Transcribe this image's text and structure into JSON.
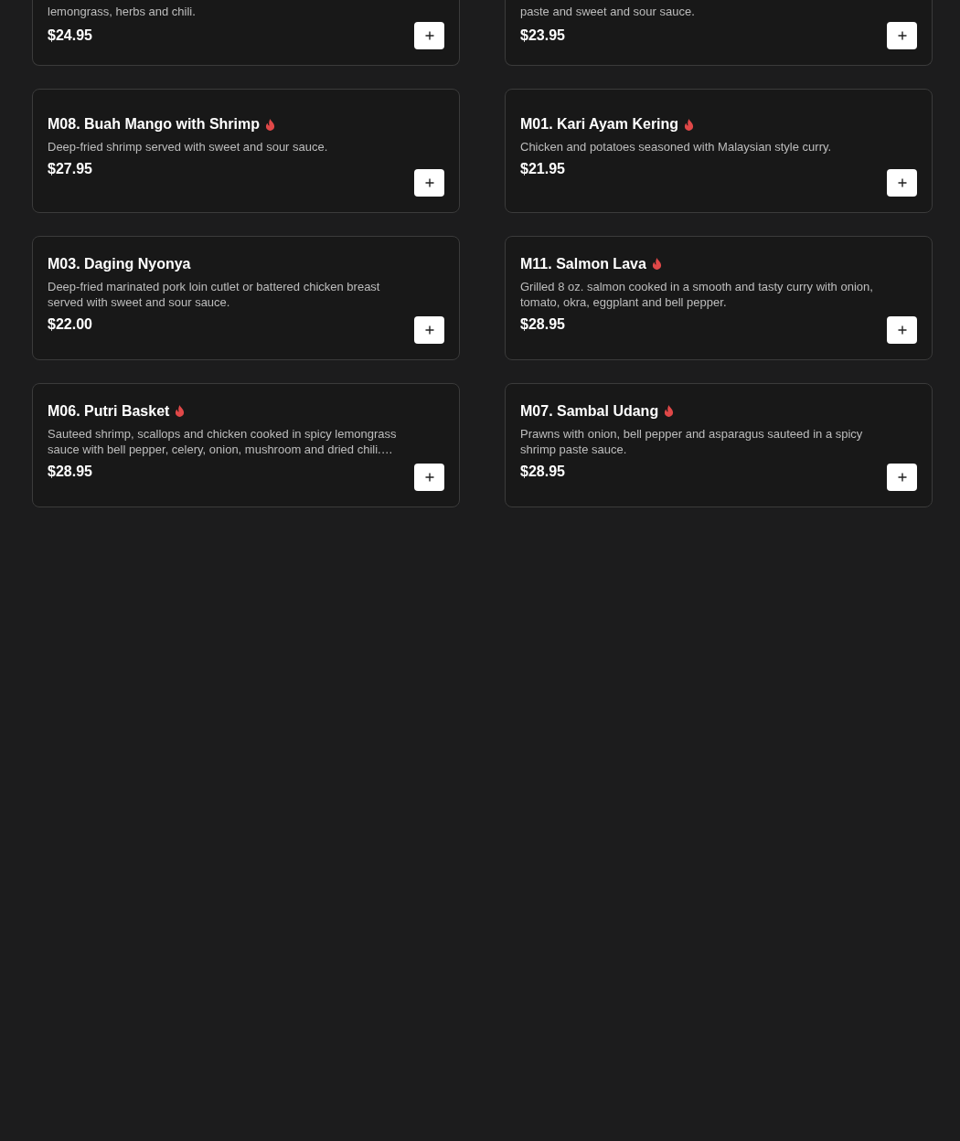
{
  "menu_items": [
    {
      "description": "lemongrass, herbs and chili.",
      "price": "$24.95"
    },
    {
      "description": "paste and sweet and sour sauce.",
      "price": "$23.95"
    },
    {
      "title": "M08. Buah Mango with Shrimp",
      "spicy": true,
      "description": "Deep-fried shrimp served with sweet and sour sauce.",
      "price": "$27.95"
    },
    {
      "title": "M01. Kari Ayam Kering",
      "spicy": true,
      "description": "Chicken and potatoes seasoned with Malaysian style curry.",
      "price": "$21.95"
    },
    {
      "title": "M03. Daging Nyonya",
      "spicy": false,
      "description": "Deep-fried marinated pork loin cutlet or battered chicken breast served with sweet and sour sauce.",
      "price": "$22.00"
    },
    {
      "title": "M11. Salmon Lava",
      "spicy": true,
      "description": "Grilled 8 oz. salmon cooked in a smooth and tasty curry with onion, tomato, okra, eggplant and bell pepper.",
      "price": "$28.95"
    },
    {
      "title": "M06. Putri Basket",
      "spicy": true,
      "description": "Sauteed shrimp, scallops and chicken cooked in spicy lemongrass sauce with bell pepper, celery, onion, mushroom and dried chili.…",
      "price": "$28.95"
    },
    {
      "title": "M07. Sambal Udang",
      "spicy": true,
      "description": "Prawns with onion, bell pepper and asparagus sauteed in a spicy shrimp paste sauce.",
      "price": "$28.95"
    }
  ]
}
